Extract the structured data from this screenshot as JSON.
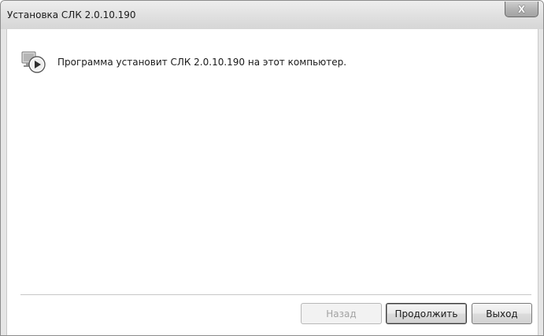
{
  "window": {
    "title": "Установка СЛК 2.0.10.190",
    "close_glyph": "X"
  },
  "content": {
    "icon": "setup-play-icon",
    "message": "Программа установит СЛК 2.0.10.190 на этот компьютер."
  },
  "buttons": {
    "back_label": "Назад",
    "back_enabled": false,
    "next_label": "Продолжить",
    "exit_label": "Выход"
  },
  "colors": {
    "titlebar": "#e2e2e2",
    "content_bg": "#ffffff",
    "disabled_text": "#a3a3a3"
  }
}
